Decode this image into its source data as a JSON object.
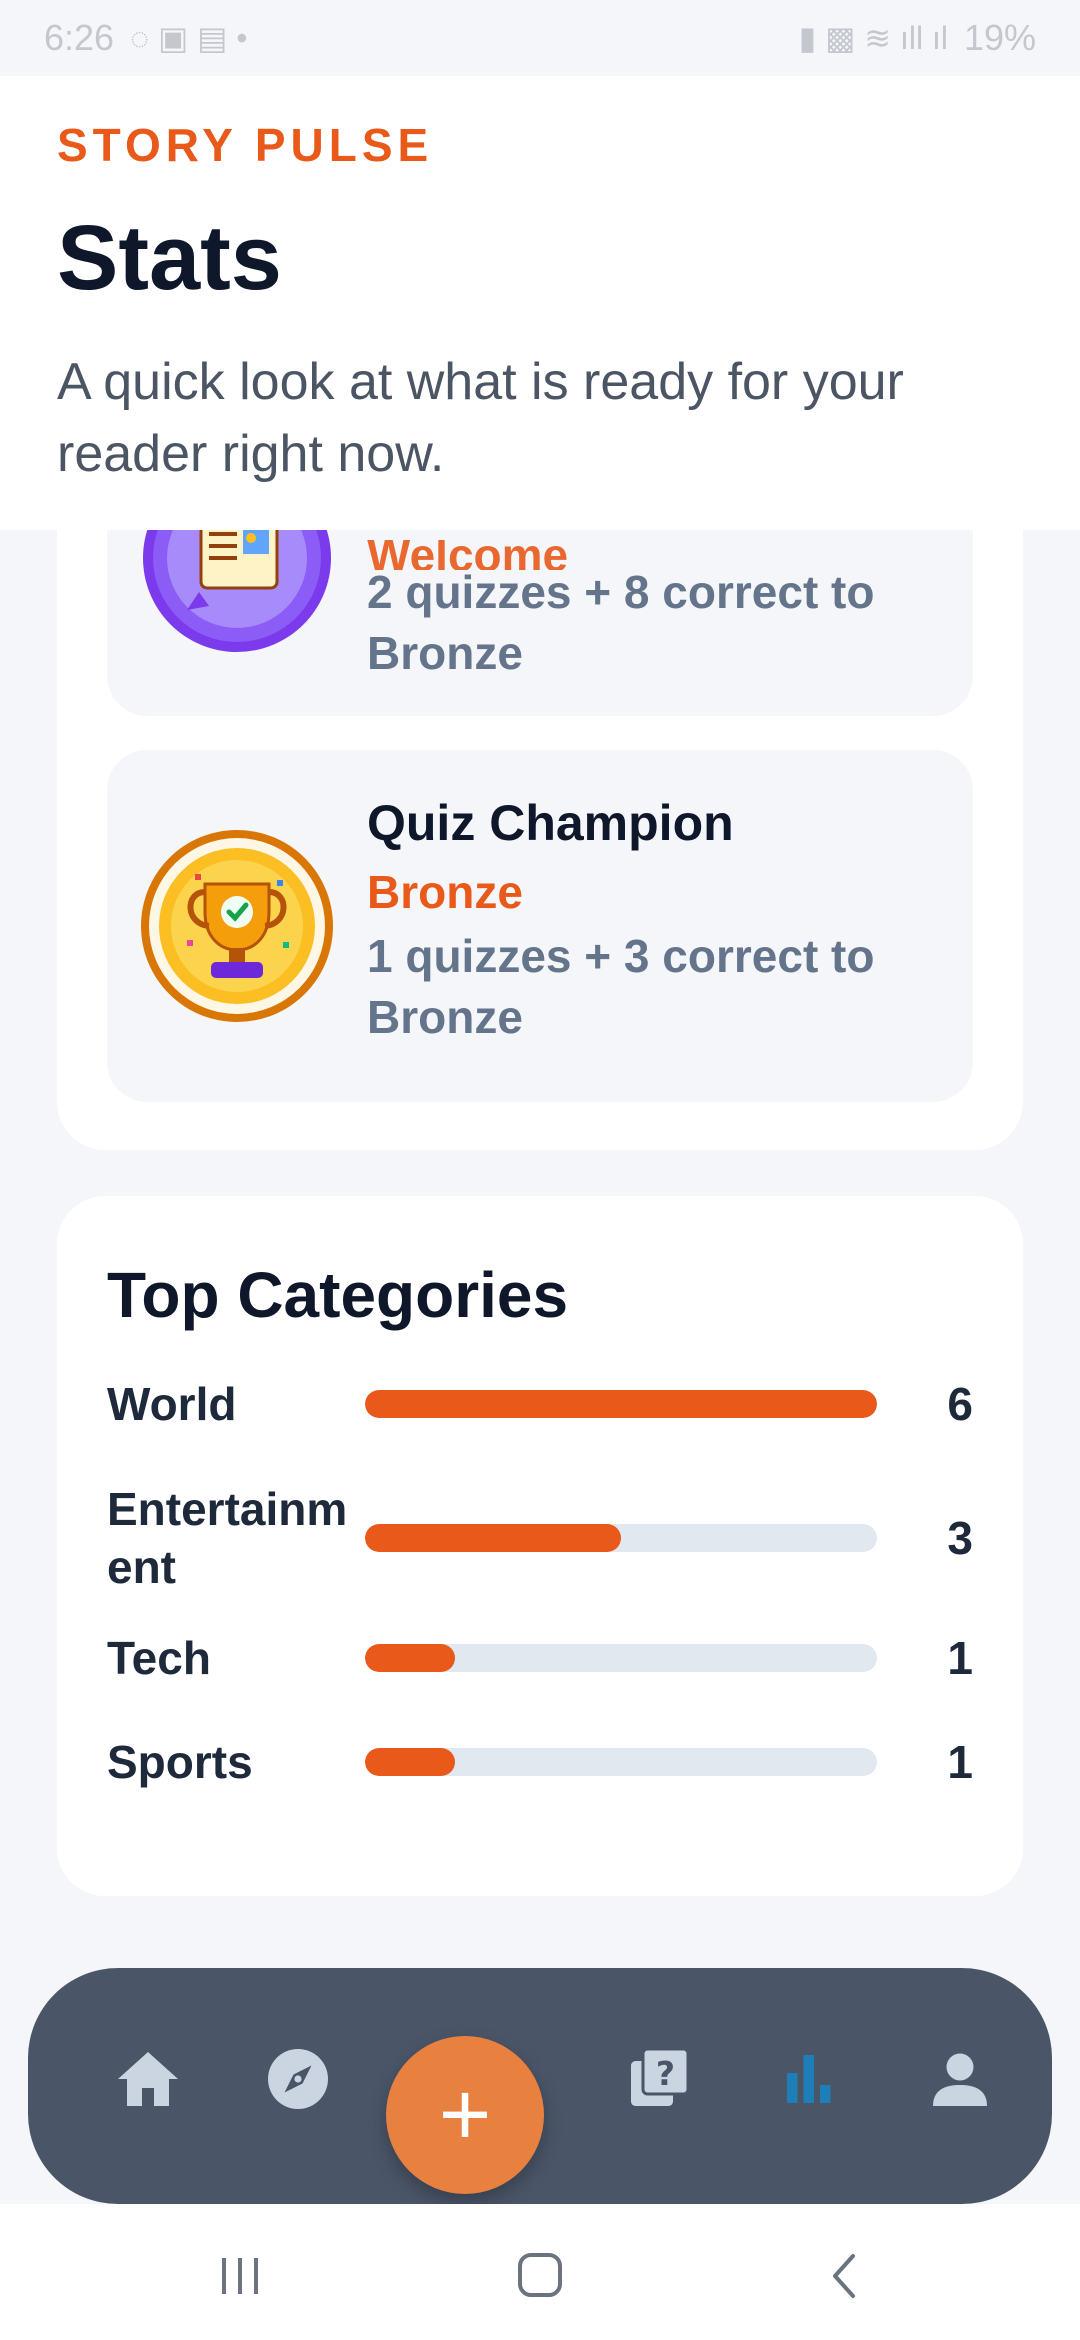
{
  "status_bar": {
    "time": "6:26",
    "battery": "19%"
  },
  "header": {
    "brand": "STORY PULSE",
    "title": "Stats",
    "subtitle": "A quick look at what is ready for your reader right now."
  },
  "achievements": {
    "items": [
      {
        "name": "",
        "tier": "Welcome",
        "progress": "2 quizzes + 8 correct to Bronze",
        "icon": "newspaper-badge-icon"
      },
      {
        "name": "Quiz Champion",
        "tier": "Bronze",
        "progress": "1 quizzes + 3 correct to Bronze",
        "icon": "trophy-badge-icon"
      }
    ]
  },
  "top_categories": {
    "title": "Top Categories",
    "max": 6,
    "items": [
      {
        "label": "World",
        "count": 6
      },
      {
        "label": "Entertainment",
        "count": 3
      },
      {
        "label": "Tech",
        "count": 1
      },
      {
        "label": "Sports",
        "count": 1
      }
    ],
    "accent_color": "#e8591a",
    "track_color": "#e2e8f0"
  },
  "bottom_nav": {
    "items": [
      "home-icon",
      "explore-icon",
      "add-icon",
      "quiz-icon",
      "stats-icon",
      "profile-icon"
    ],
    "active": "stats-icon",
    "fab_label": "+",
    "active_color": "#1e7fb8",
    "inactive_color": "#cbd5e1"
  }
}
